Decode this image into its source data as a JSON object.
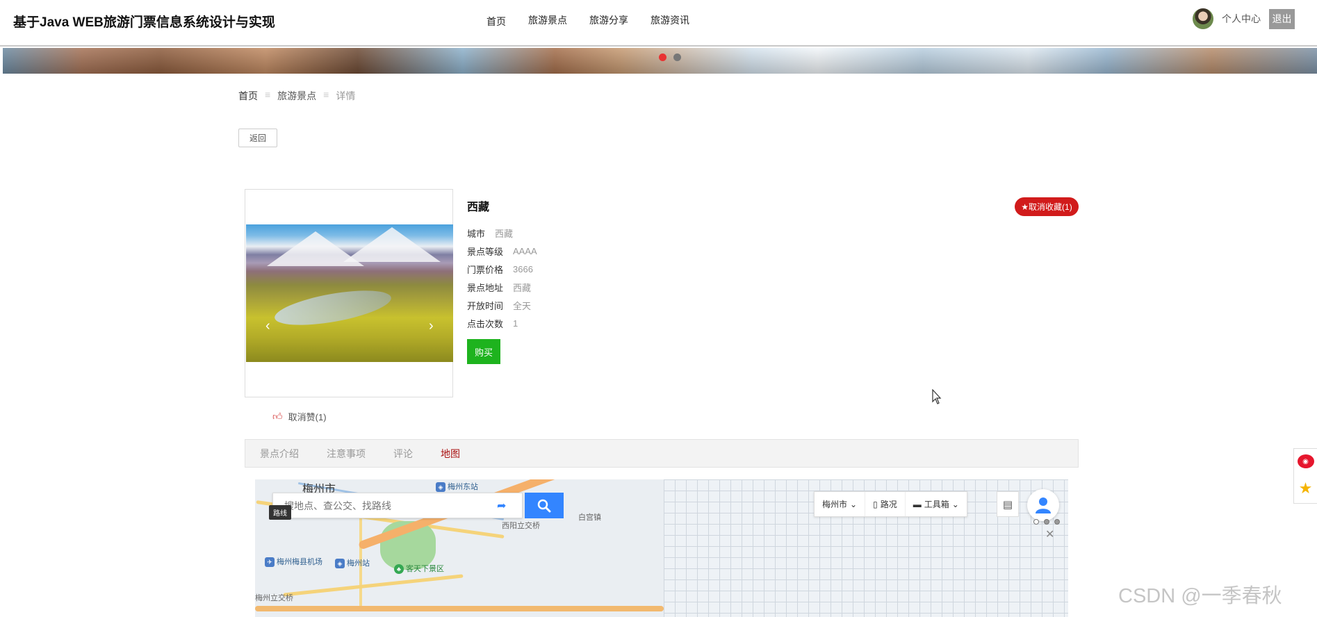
{
  "header": {
    "title": "基于Java WEB旅游门票信息系统设计与实现",
    "nav": [
      "首页",
      "旅游景点",
      "旅游分享",
      "旅游资讯"
    ],
    "user_center": "个人中心",
    "logout": "退出"
  },
  "breadcrumb": {
    "home": "首页",
    "section": "旅游景点",
    "current": "详情",
    "separator": "≡"
  },
  "back_button": "返回",
  "detail": {
    "name": "西藏",
    "fields": [
      {
        "label": "城市",
        "value": "西藏"
      },
      {
        "label": "景点等级",
        "value": "AAAA"
      },
      {
        "label": "门票价格",
        "value": "3666"
      },
      {
        "label": "景点地址",
        "value": "西藏"
      },
      {
        "label": "开放时间",
        "value": "全天"
      },
      {
        "label": "点击次数",
        "value": "1"
      }
    ],
    "buy": "购买",
    "favorite": "★取消收藏(1)",
    "like": "取消赞(1)"
  },
  "tabs": [
    "景点介绍",
    "注意事项",
    "评论",
    "地图"
  ],
  "active_tab": 3,
  "map": {
    "search_placeholder": "搜地点、查公交、找路线",
    "route_tag": "路线",
    "city_select": "梅州市",
    "traffic": "路况",
    "toolbox": "工具箱",
    "places": {
      "city": "梅州市",
      "east_station": "梅州东站",
      "interchange_w": "西阳立交桥",
      "baigong": "白宫镇",
      "airport": "梅州梅县机场",
      "station": "梅州站",
      "scenic": "客天下景区",
      "interchange": "梅州立交桥"
    }
  },
  "watermark": "CSDN @一季春秋",
  "colors": {
    "active_tab": "#aa1111",
    "favorite": "#d11b1b",
    "buy": "#1eb31e",
    "map_search": "#3385ff"
  }
}
